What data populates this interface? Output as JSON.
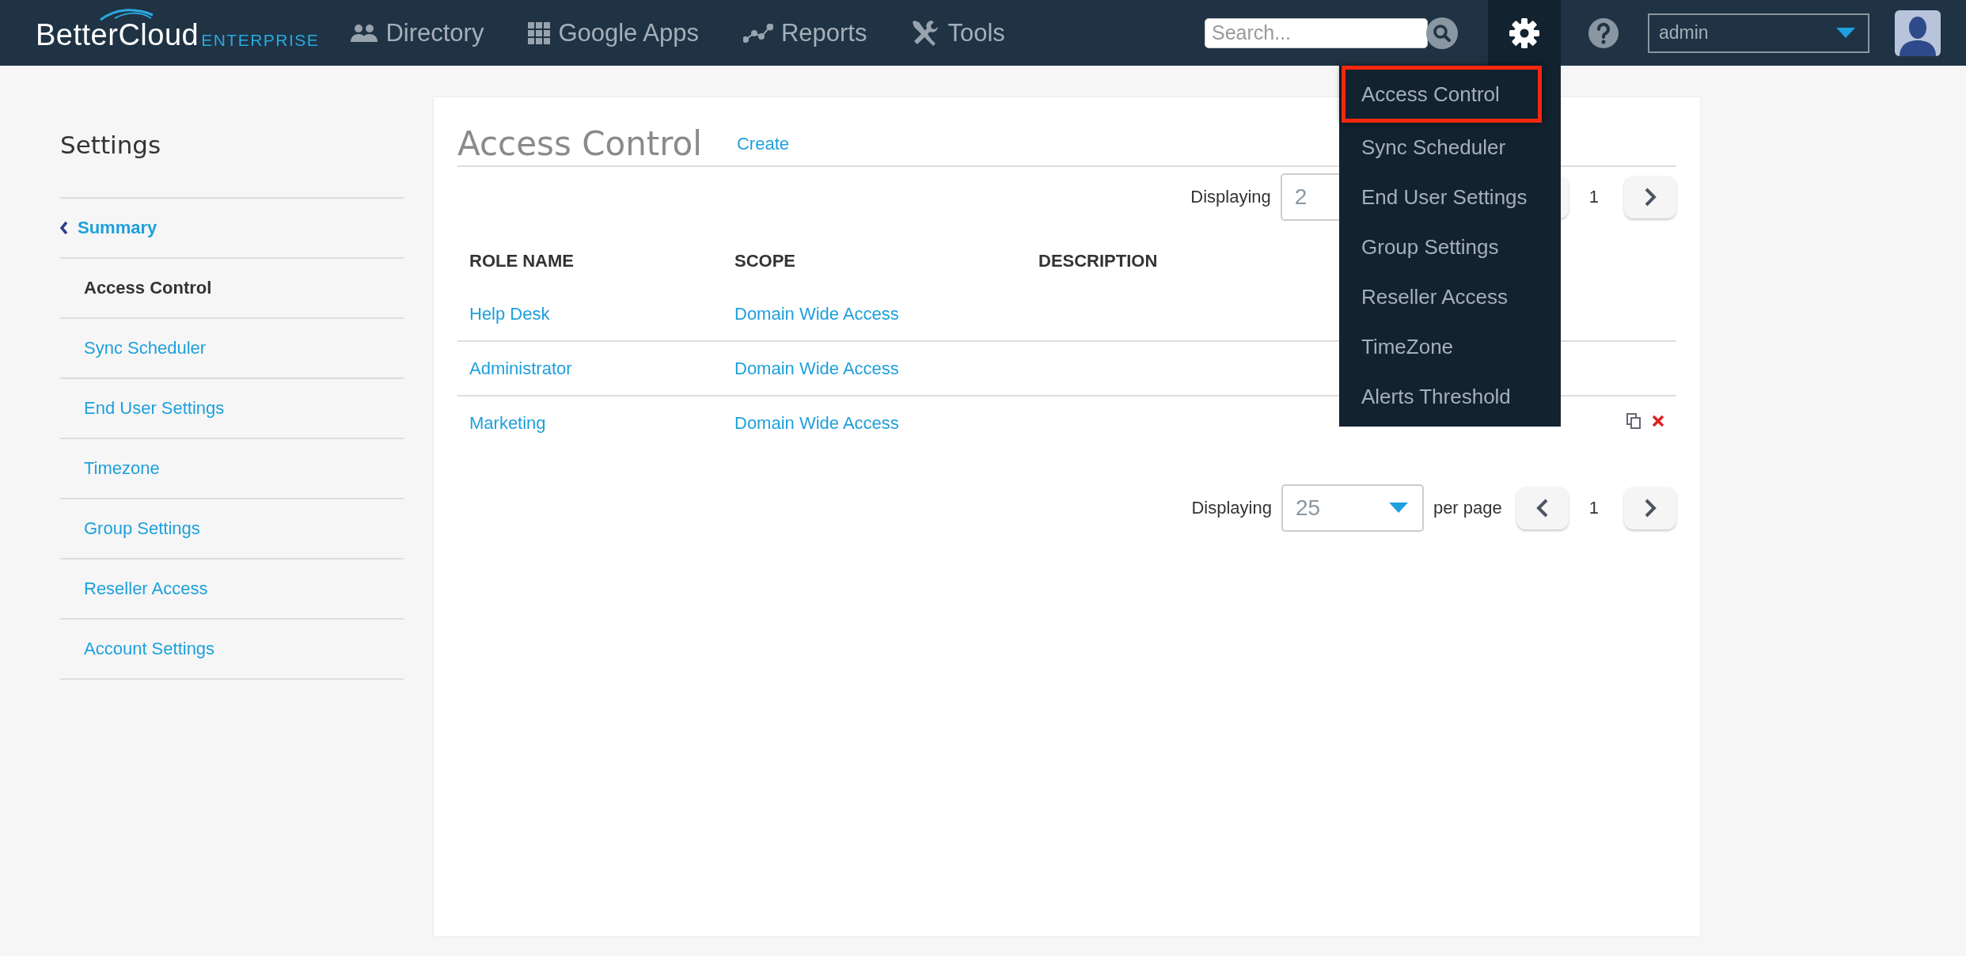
{
  "header": {
    "logo": {
      "name": "BetterCloud",
      "edition": "ENTERPRISE"
    },
    "nav": [
      {
        "label": "Directory"
      },
      {
        "label": "Google Apps"
      },
      {
        "label": "Reports"
      },
      {
        "label": "Tools"
      }
    ],
    "search": {
      "placeholder": "Search..."
    },
    "user_select": {
      "value": "admin"
    }
  },
  "sidebar": {
    "title": "Settings",
    "back_link": "Summary",
    "items": [
      {
        "label": "Access Control",
        "selected": true
      },
      {
        "label": "Sync Scheduler",
        "selected": false
      },
      {
        "label": "End User Settings",
        "selected": false
      },
      {
        "label": "Timezone",
        "selected": false
      },
      {
        "label": "Group Settings",
        "selected": false
      },
      {
        "label": "Reseller Access",
        "selected": false
      },
      {
        "label": "Account Settings",
        "selected": false
      }
    ]
  },
  "main": {
    "title": "Access Control",
    "create_link": "Create",
    "pager_top": {
      "label": "Displaying",
      "value": "2",
      "page": "1"
    },
    "table": {
      "columns": [
        "ROLE NAME",
        "SCOPE",
        "DESCRIPTION"
      ],
      "rows": [
        {
          "role": "Help Desk",
          "scope": "Domain Wide Access",
          "actions_shown": false
        },
        {
          "role": "Administrator",
          "scope": "Domain Wide Access",
          "actions_shown": false
        },
        {
          "role": "Marketing",
          "scope": "Domain Wide Access",
          "actions_shown": true
        }
      ]
    },
    "pager_bottom": {
      "label": "Displaying",
      "value": "25",
      "suffix": "per page",
      "page": "1"
    }
  },
  "settings_menu": {
    "items": [
      {
        "label": "Access Control",
        "selected": true
      },
      {
        "label": "Sync Scheduler",
        "selected": false
      },
      {
        "label": "End User Settings",
        "selected": false
      },
      {
        "label": "Group Settings",
        "selected": false
      },
      {
        "label": "Reseller Access",
        "selected": false
      },
      {
        "label": "TimeZone",
        "selected": false
      },
      {
        "label": "Alerts Threshold",
        "selected": false
      }
    ]
  }
}
